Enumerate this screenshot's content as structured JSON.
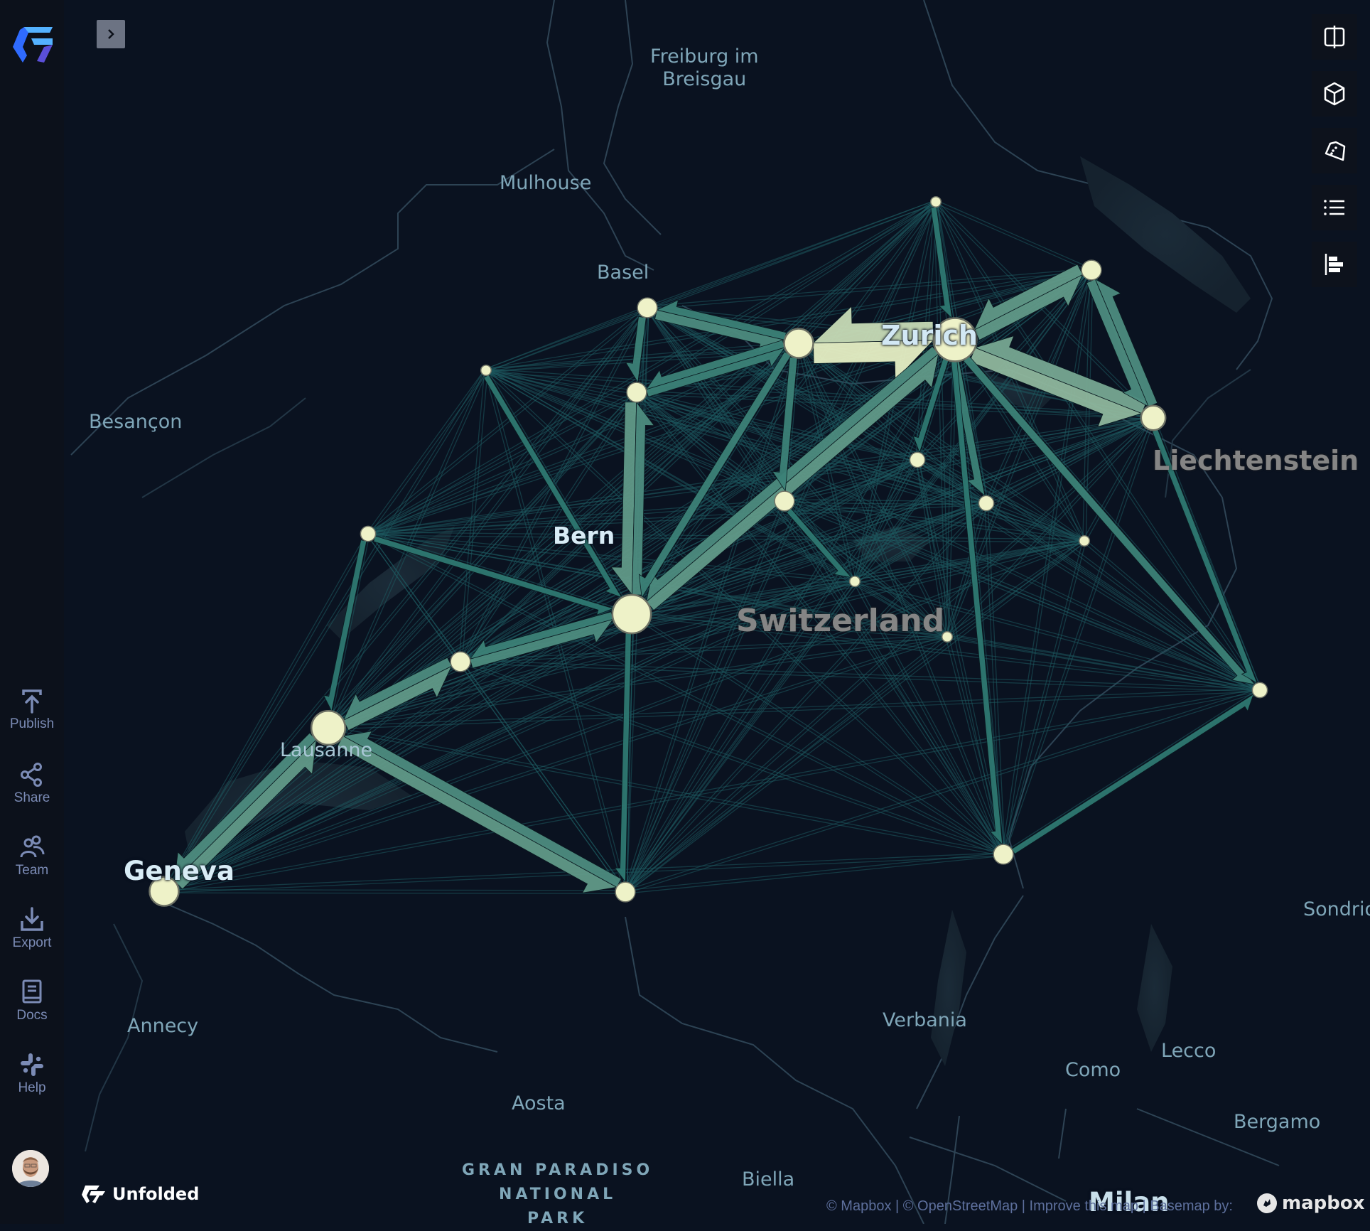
{
  "app": {
    "brand": "Unfolded",
    "expand_panel_icon": "chevron-right-icon"
  },
  "sidebar": {
    "items": [
      {
        "label": "Publish",
        "icon": "upload-icon"
      },
      {
        "label": "Share",
        "icon": "share-icon"
      },
      {
        "label": "Team",
        "icon": "team-icon"
      },
      {
        "label": "Export",
        "icon": "download-icon"
      },
      {
        "label": "Docs",
        "icon": "book-icon"
      },
      {
        "label": "Help",
        "icon": "slack-icon"
      }
    ],
    "avatar": "user-avatar"
  },
  "toolbar": {
    "items": [
      {
        "name": "split-map",
        "icon": "split-map-icon"
      },
      {
        "name": "3d-view",
        "icon": "cube-icon"
      },
      {
        "name": "draw-polygon",
        "icon": "polygon-icon"
      },
      {
        "name": "layer-legend",
        "icon": "list-icon"
      },
      {
        "name": "map-layers",
        "icon": "align-left-bars-icon"
      }
    ]
  },
  "map": {
    "labels": [
      {
        "text": "Freiburg im",
        "type": "city"
      },
      {
        "text": "Breisgau",
        "type": "city"
      },
      {
        "text": "Mulhouse",
        "type": "city"
      },
      {
        "text": "Basel",
        "type": "city"
      },
      {
        "text": "Besançon",
        "type": "city"
      },
      {
        "text": "Zurich",
        "type": "major"
      },
      {
        "text": "Liechtenstein",
        "type": "country"
      },
      {
        "text": "Bern",
        "type": "major"
      },
      {
        "text": "Switzerland",
        "type": "country"
      },
      {
        "text": "Lausanne",
        "type": "city"
      },
      {
        "text": "Geneva",
        "type": "major"
      },
      {
        "text": "Sondrio",
        "type": "city"
      },
      {
        "text": "Annecy",
        "type": "city"
      },
      {
        "text": "Verbania",
        "type": "city"
      },
      {
        "text": "Lecco",
        "type": "city"
      },
      {
        "text": "Como",
        "type": "city"
      },
      {
        "text": "Aosta",
        "type": "city"
      },
      {
        "text": "Bergamo",
        "type": "city"
      },
      {
        "text": "GRAN PARADISO",
        "type": "park"
      },
      {
        "text": "NATIONAL",
        "type": "park"
      },
      {
        "text": "PARK",
        "type": "park"
      },
      {
        "text": "Biella",
        "type": "city"
      },
      {
        "text": "Milan",
        "type": "major"
      }
    ],
    "flow_layer": {
      "node_color": "#eef2c8",
      "flow_color_low": "#1d5a60",
      "flow_color_high": "#e6efc4",
      "nodes": [
        {
          "id": "n1",
          "size": 1
        },
        {
          "id": "n2",
          "size": 3
        },
        {
          "id": "basel",
          "size": 3
        },
        {
          "id": "n4",
          "size": 5
        },
        {
          "id": "zurich",
          "size": 8
        },
        {
          "id": "n6",
          "size": 1
        },
        {
          "id": "n7",
          "size": 3
        },
        {
          "id": "n8",
          "size": 4
        },
        {
          "id": "n9",
          "size": 2
        },
        {
          "id": "n10",
          "size": 3
        },
        {
          "id": "n11",
          "size": 2
        },
        {
          "id": "n12",
          "size": 1
        },
        {
          "id": "n13",
          "size": 2
        },
        {
          "id": "n14",
          "size": 1
        },
        {
          "id": "bern",
          "size": 7
        },
        {
          "id": "n16",
          "size": 1
        },
        {
          "id": "n17",
          "size": 3
        },
        {
          "id": "n18",
          "size": 2
        },
        {
          "id": "lausanne",
          "size": 6
        },
        {
          "id": "n20",
          "size": 3
        },
        {
          "id": "geneva",
          "size": 5
        },
        {
          "id": "n22",
          "size": 3
        }
      ],
      "major_flows": [
        {
          "from": "n4",
          "to": "zurich",
          "weight": 10
        },
        {
          "from": "zurich",
          "to": "n4",
          "weight": 9
        },
        {
          "from": "zurich",
          "to": "n8",
          "weight": 7
        },
        {
          "from": "n8",
          "to": "zurich",
          "weight": 6
        },
        {
          "from": "zurich",
          "to": "n2",
          "weight": 5
        },
        {
          "from": "n2",
          "to": "zurich",
          "weight": 5
        },
        {
          "from": "n2",
          "to": "n8",
          "weight": 4
        },
        {
          "from": "n8",
          "to": "n2",
          "weight": 4
        },
        {
          "from": "bern",
          "to": "zurich",
          "weight": 5
        },
        {
          "from": "zurich",
          "to": "bern",
          "weight": 4
        },
        {
          "from": "n7",
          "to": "bern",
          "weight": 5
        },
        {
          "from": "bern",
          "to": "n7",
          "weight": 4
        },
        {
          "from": "lausanne",
          "to": "n17",
          "weight": 5
        },
        {
          "from": "n17",
          "to": "lausanne",
          "weight": 4
        },
        {
          "from": "n17",
          "to": "bern",
          "weight": 4
        },
        {
          "from": "bern",
          "to": "n17",
          "weight": 3
        },
        {
          "from": "geneva",
          "to": "lausanne",
          "weight": 5
        },
        {
          "from": "lausanne",
          "to": "geneva",
          "weight": 4
        },
        {
          "from": "lausanne",
          "to": "n22",
          "weight": 5
        },
        {
          "from": "n22",
          "to": "lausanne",
          "weight": 4
        },
        {
          "from": "basel",
          "to": "n4",
          "weight": 4
        },
        {
          "from": "n4",
          "to": "basel",
          "weight": 3
        },
        {
          "from": "n4",
          "to": "n7",
          "weight": 3
        },
        {
          "from": "n7",
          "to": "n4",
          "weight": 3
        },
        {
          "from": "basel",
          "to": "n7",
          "weight": 3
        },
        {
          "from": "n4",
          "to": "n10",
          "weight": 3
        },
        {
          "from": "n4",
          "to": "bern",
          "weight": 3
        },
        {
          "from": "zurich",
          "to": "n11",
          "weight": 3
        },
        {
          "from": "zurich",
          "to": "n9",
          "weight": 2
        },
        {
          "from": "zurich",
          "to": "n20",
          "weight": 2
        },
        {
          "from": "zurich",
          "to": "n18",
          "weight": 3
        },
        {
          "from": "n8",
          "to": "n18",
          "weight": 2
        },
        {
          "from": "n1",
          "to": "zurich",
          "weight": 2
        },
        {
          "from": "n13",
          "to": "lausanne",
          "weight": 2
        },
        {
          "from": "n13",
          "to": "bern",
          "weight": 2
        },
        {
          "from": "n6",
          "to": "bern",
          "weight": 2
        },
        {
          "from": "n10",
          "to": "n14",
          "weight": 2
        },
        {
          "from": "bern",
          "to": "n22",
          "weight": 2
        },
        {
          "from": "n20",
          "to": "n18",
          "weight": 2
        }
      ]
    }
  },
  "attribution": {
    "text": "© Mapbox | © OpenStreetMap | Improve this map | Basemap by:",
    "provider": "mapbox"
  }
}
